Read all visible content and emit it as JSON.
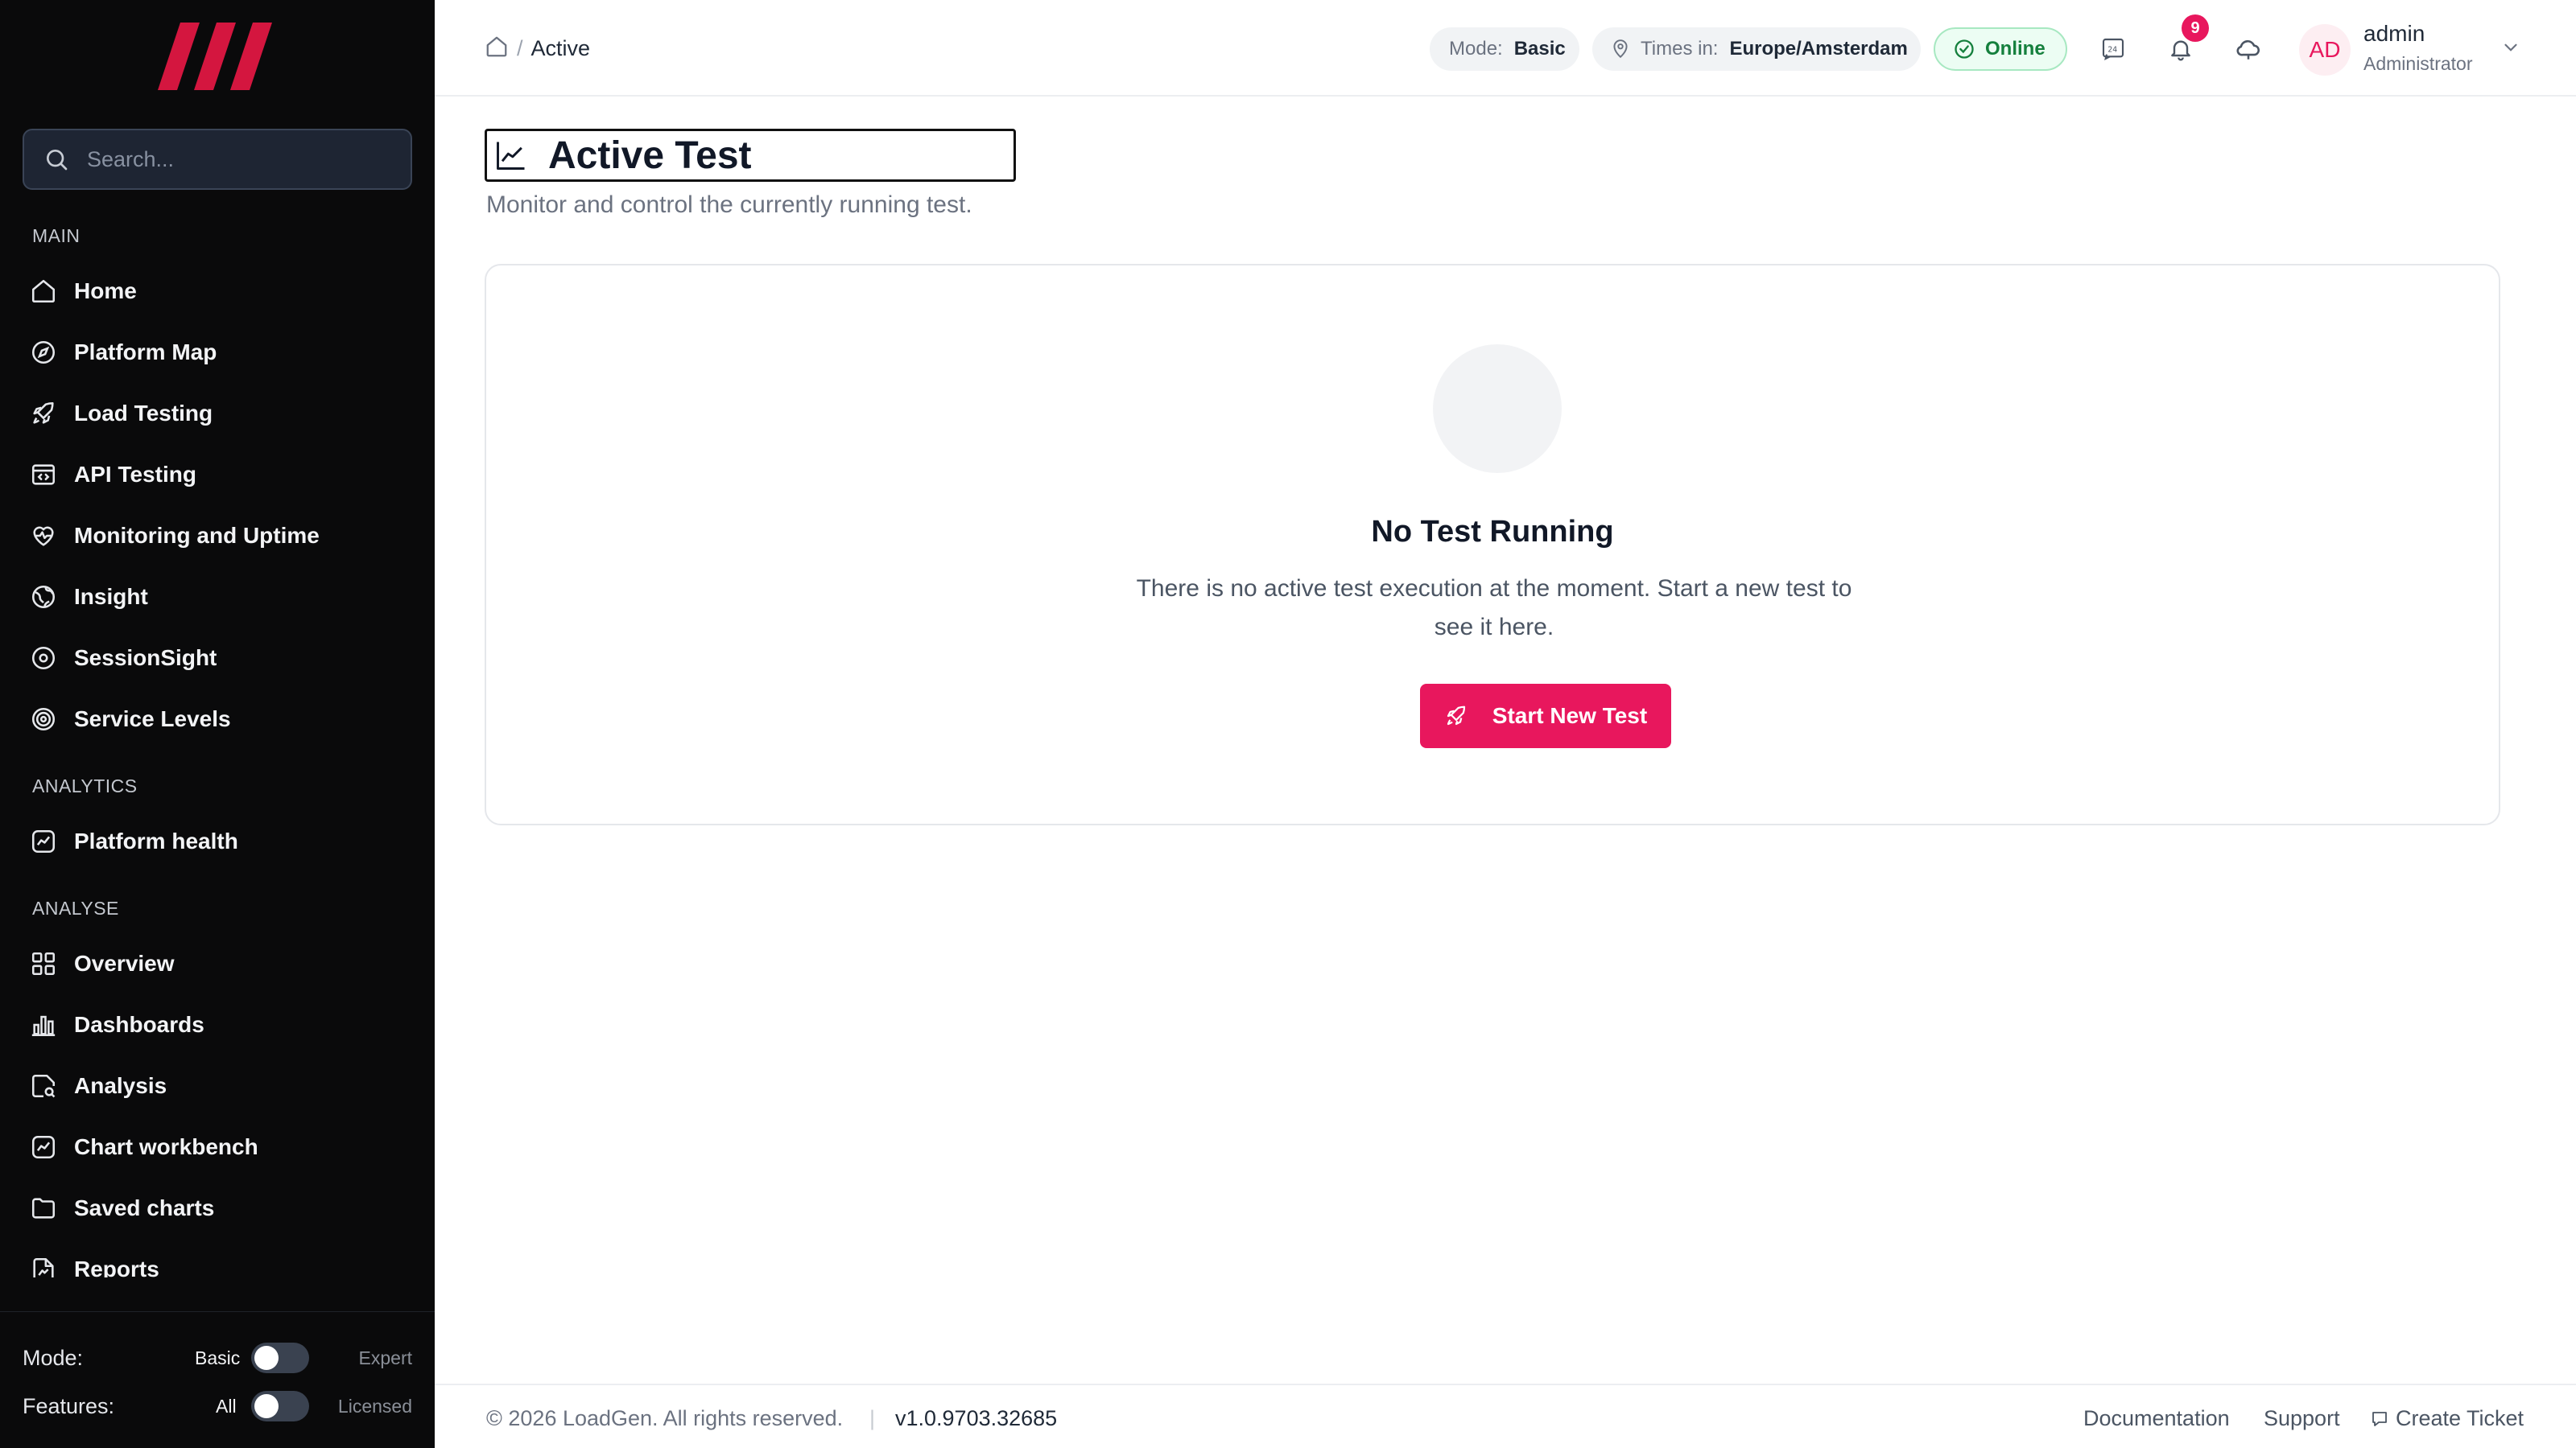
{
  "sidebar": {
    "search_placeholder": "Search...",
    "sections": {
      "main": "MAIN",
      "analytics": "ANALYTICS",
      "analyse": "ANALYSE"
    },
    "main_items": [
      {
        "label": "Home",
        "icon": "home-icon"
      },
      {
        "label": "Platform Map",
        "icon": "compass-icon"
      },
      {
        "label": "Load Testing",
        "icon": "rocket-icon"
      },
      {
        "label": "API Testing",
        "icon": "code-window-icon"
      },
      {
        "label": "Monitoring and Uptime",
        "icon": "heart-pulse-icon"
      },
      {
        "label": "Insight",
        "icon": "globe-icon"
      },
      {
        "label": "SessionSight",
        "icon": "eye-icon"
      },
      {
        "label": "Service Levels",
        "icon": "target-icon"
      }
    ],
    "analytics_items": [
      {
        "label": "Platform health",
        "icon": "trend-icon"
      }
    ],
    "analyse_items": [
      {
        "label": "Overview",
        "icon": "grid-icon"
      },
      {
        "label": "Dashboards",
        "icon": "bar-chart-icon"
      },
      {
        "label": "Analysis",
        "icon": "file-search-icon"
      },
      {
        "label": "Chart workbench",
        "icon": "chart-line-icon"
      },
      {
        "label": "Saved charts",
        "icon": "folder-icon"
      },
      {
        "label": "Reports",
        "icon": "report-icon"
      }
    ],
    "footer": {
      "mode_label": "Mode:",
      "mode_left": "Basic",
      "mode_right": "Expert",
      "features_label": "Features:",
      "features_left": "All",
      "features_right": "Licensed"
    }
  },
  "header": {
    "breadcrumb_current": "Active",
    "mode_key": "Mode:",
    "mode_value": "Basic",
    "times_key": "Times in:",
    "times_value": "Europe/Amsterdam",
    "status": "Online",
    "notification_count": "9",
    "user_initials": "AD",
    "user_name": "admin",
    "user_role": "Administrator"
  },
  "page": {
    "title": "Active Test",
    "subtitle": "Monitor and control the currently running test."
  },
  "empty_state": {
    "title": "No Test Running",
    "description": "There is no active test execution at the moment. Start a new test to see it here.",
    "button_label": "Start New Test"
  },
  "footer": {
    "copyright": "© 2026 LoadGen. All rights reserved.",
    "divider": "|",
    "version": "v1.0.9703.32685",
    "links": [
      "Documentation",
      "Support",
      "Create Ticket"
    ]
  },
  "colors": {
    "accent": "#e8175d",
    "sidebar_bg": "#0a0a0b",
    "online": "#15803d"
  }
}
